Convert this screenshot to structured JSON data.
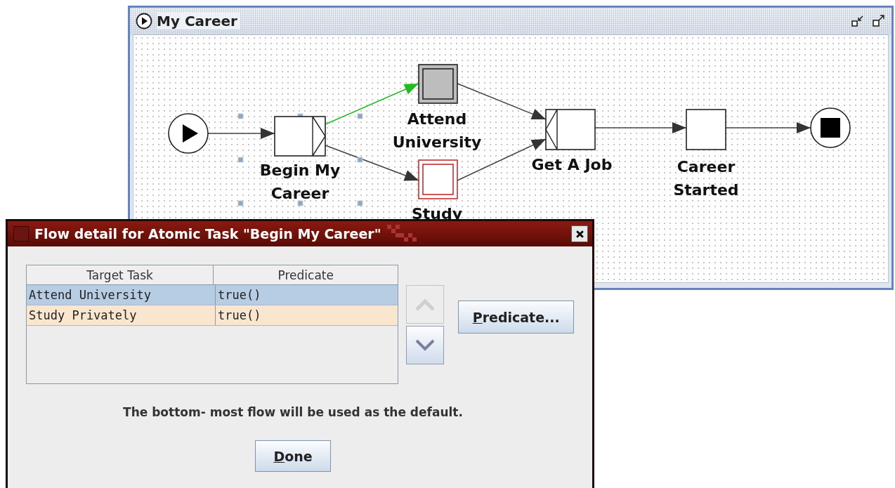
{
  "editor": {
    "title": "My Career",
    "nodes": [
      {
        "kind": "start"
      },
      {
        "kind": "task",
        "lines": [
          "Begin My",
          "Career"
        ],
        "selected": true,
        "split": true,
        "join": false
      },
      {
        "kind": "composite",
        "lines": [
          "Attend",
          "University"
        ],
        "selected": false,
        "split": false,
        "join": false
      },
      {
        "kind": "multiple",
        "lines": [
          "Study"
        ],
        "selected": false,
        "split": false,
        "join": false
      },
      {
        "kind": "task",
        "lines": [
          "Get A Job"
        ],
        "selected": false,
        "split": false,
        "join": true
      },
      {
        "kind": "task",
        "lines": [
          "Career",
          "Started"
        ],
        "selected": false,
        "split": false,
        "join": false
      },
      {
        "kind": "end"
      }
    ],
    "flows": [
      {
        "selected": false
      },
      {
        "selected": true
      },
      {
        "selected": false
      },
      {
        "selected": false
      },
      {
        "selected": false
      },
      {
        "selected": false
      },
      {
        "selected": false
      }
    ]
  },
  "dialog": {
    "title": "Flow detail for Atomic Task \"Begin My Career\"",
    "table": {
      "columns": [
        "Target Task",
        "Predicate"
      ],
      "rows": [
        {
          "cells": [
            "Attend University",
            "true()"
          ],
          "selected": true,
          "default": false
        },
        {
          "cells": [
            "Study Privately",
            "true()"
          ],
          "selected": false,
          "default": true
        }
      ]
    },
    "move_up": {
      "disabled": true
    },
    "move_down": {
      "disabled": false
    },
    "predicate_button": "Predicate...",
    "note": "The bottom- most flow will be used as the default.",
    "done_button": "Done"
  }
}
